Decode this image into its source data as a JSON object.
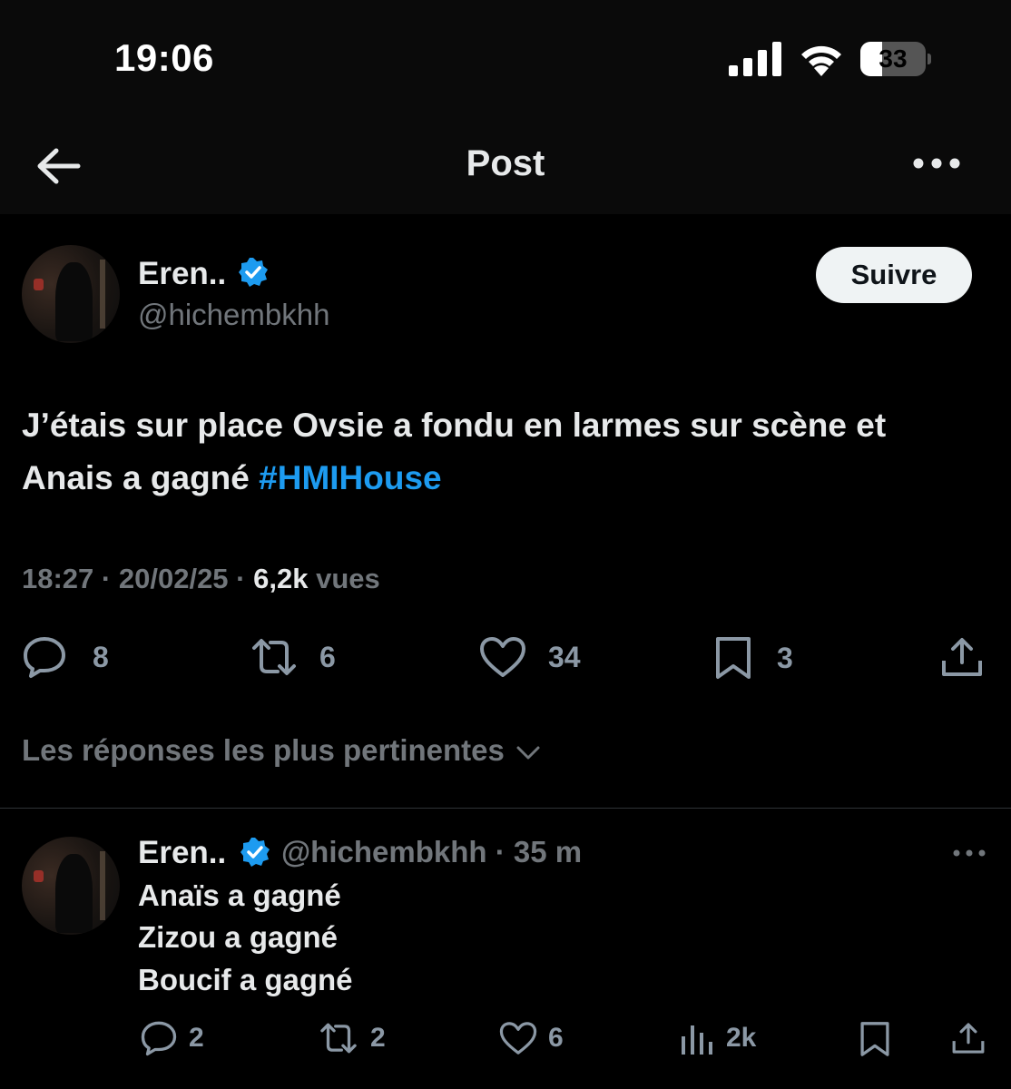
{
  "status_bar": {
    "time": "19:06",
    "battery_level": "33",
    "battery_fraction": 0.33
  },
  "header": {
    "title": "Post"
  },
  "post": {
    "author_name": "Eren..",
    "author_handle": "@hichembkhh",
    "follow_label": "Suivre",
    "text_line1": "J’étais sur place Ovsie a fondu en larmes sur scène et",
    "text_line2_prefix": "Anais a gagné ",
    "hashtag": "#HMIHouse",
    "time": "18:27",
    "date": "20/02/25",
    "views_count": "6,2k",
    "views_label": "vues",
    "separator": "·",
    "stats": {
      "replies": "8",
      "reposts": "6",
      "likes": "34",
      "bookmarks": "3"
    }
  },
  "replies_sort": {
    "label": "Les réponses les plus pertinentes"
  },
  "reply": {
    "author_name": "Eren..",
    "author_handle": "@hichembkhh",
    "time": "35 m",
    "separator": "·",
    "lines": [
      "Anaïs a gagné",
      "Zizou a gagné",
      "Boucif a gagné"
    ],
    "stats": {
      "replies": "2",
      "reposts": "2",
      "likes": "6",
      "views": "2k"
    }
  },
  "colors": {
    "accent": "#1d9bf0",
    "text": "#e7e9ea",
    "muted": "#71767b",
    "background": "#000000"
  }
}
